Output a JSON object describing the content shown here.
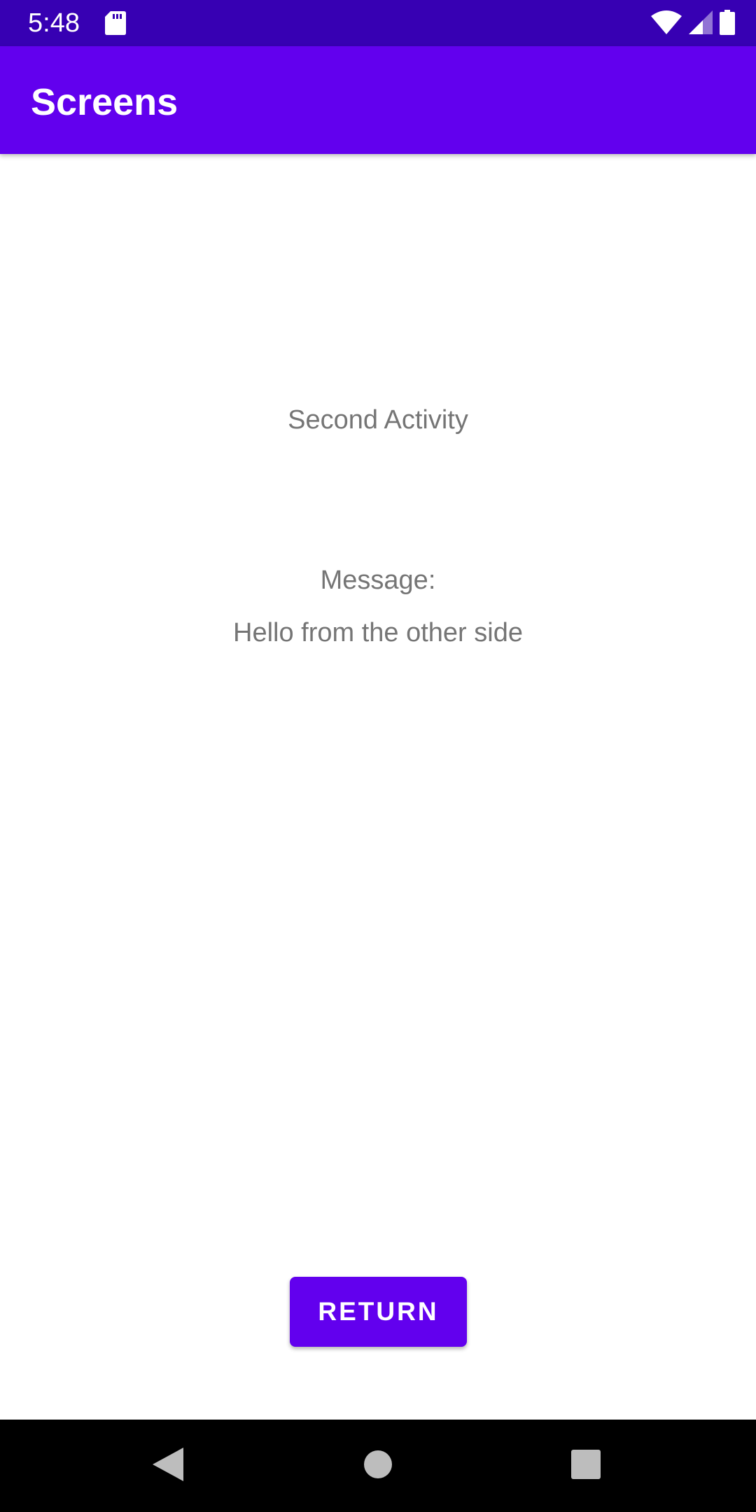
{
  "status_bar": {
    "time": "5:48",
    "icons": [
      "sd-card-icon",
      "wifi-icon",
      "cellular-signal-icon",
      "battery-icon"
    ],
    "color": "#3700b3"
  },
  "app_bar": {
    "title": "Screens",
    "color": "#6200ee"
  },
  "main": {
    "heading": "Second Activity",
    "message_label": "Message:",
    "message_text": "Hello from the other side"
  },
  "actions": {
    "return_label": "RETURN",
    "button_color": "#6200ee"
  },
  "nav_bar": {
    "buttons": [
      "back-icon",
      "home-icon",
      "recents-icon"
    ]
  }
}
